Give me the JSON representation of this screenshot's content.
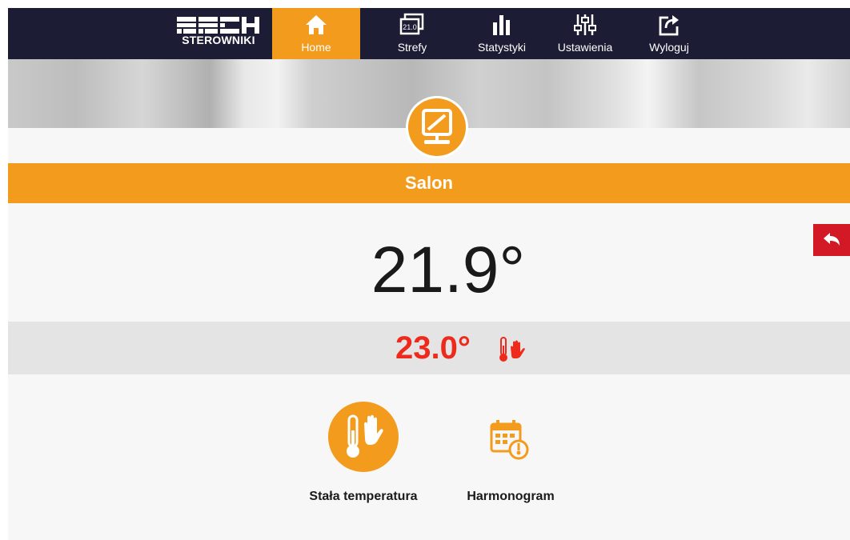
{
  "brand": {
    "logo_text": "TECH",
    "logo_sub": "STEROWNIKI"
  },
  "nav": [
    {
      "label": "Home",
      "icon": "home-icon",
      "active": true
    },
    {
      "label": "Strefy",
      "icon": "zones-icon",
      "badge": "21.0"
    },
    {
      "label": "Statystyki",
      "icon": "statistics-icon"
    },
    {
      "label": "Ustawienia",
      "icon": "settings-sliders-icon"
    },
    {
      "label": "Wyloguj",
      "icon": "logout-icon"
    }
  ],
  "zone": {
    "name": "Salon",
    "icon": "zone-display-icon"
  },
  "temperature": {
    "current": "21.9°",
    "setpoint": "23.0°"
  },
  "modes": [
    {
      "label": "Stała temperatura",
      "icon": "thermometer-hand-icon",
      "active": true
    },
    {
      "label": "Harmonogram",
      "icon": "calendar-clock-icon",
      "active": false
    }
  ],
  "colors": {
    "accent": "#f39b1c",
    "topbar": "#1c1c34",
    "setpoint": "#ee2a1c",
    "back": "#d31925"
  }
}
